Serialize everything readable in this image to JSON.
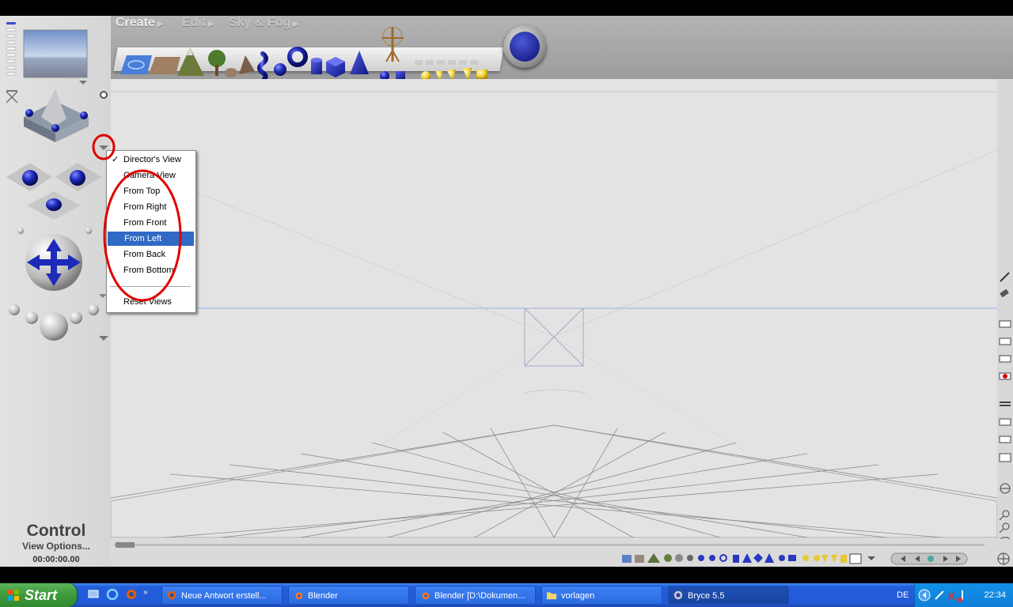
{
  "app": {
    "menu": [
      {
        "label": "Create",
        "state": "active"
      },
      {
        "label": "Edit",
        "state": "inactive"
      },
      {
        "label": "Sky & Fog",
        "state": "inactive"
      }
    ],
    "create_objects": [
      "water-plane-icon",
      "ground-plane-icon",
      "terrain-icon",
      "tree-icon",
      "rock-icon",
      "symmetrical-lattice-icon",
      "metaball-icon",
      "sphere-icon",
      "torus-icon",
      "cylinder-icon",
      "cube-icon",
      "cone-icon",
      "human-figure-icon",
      "lights-icon"
    ],
    "logo_name": "bryce-logo-button"
  },
  "control": {
    "title": "Control",
    "subtitle": "View Options...",
    "time": "00:00:00.00"
  },
  "view_menu": {
    "items": [
      {
        "label": "Director's View",
        "checked": true
      },
      {
        "label": "Camera View"
      },
      {
        "label": "From Top"
      },
      {
        "label": "From Right"
      },
      {
        "label": "From Front"
      },
      {
        "label": "From Left",
        "highlighted": true
      },
      {
        "label": "From Back"
      },
      {
        "label": "From Bottom"
      },
      {
        "label": "Reset Views"
      }
    ],
    "check_mark": "✓"
  },
  "colors": {
    "highlight": "#316ac5",
    "annotation": "#e00000",
    "horizon": "#8db4e8"
  },
  "taskbar": {
    "start_label": "Start",
    "tasks": [
      {
        "label": "Neue Antwort erstell...",
        "icon": "firefox-icon"
      },
      {
        "label": "Blender",
        "icon": "blender-icon"
      },
      {
        "label": "Blender [D:\\Dokumen...",
        "icon": "blender-icon"
      },
      {
        "label": "vorlagen",
        "icon": "folder-icon"
      },
      {
        "label": "Bryce 5.5",
        "icon": "bryce-icon",
        "active": true
      }
    ],
    "language": "DE",
    "clock": "22:34"
  }
}
